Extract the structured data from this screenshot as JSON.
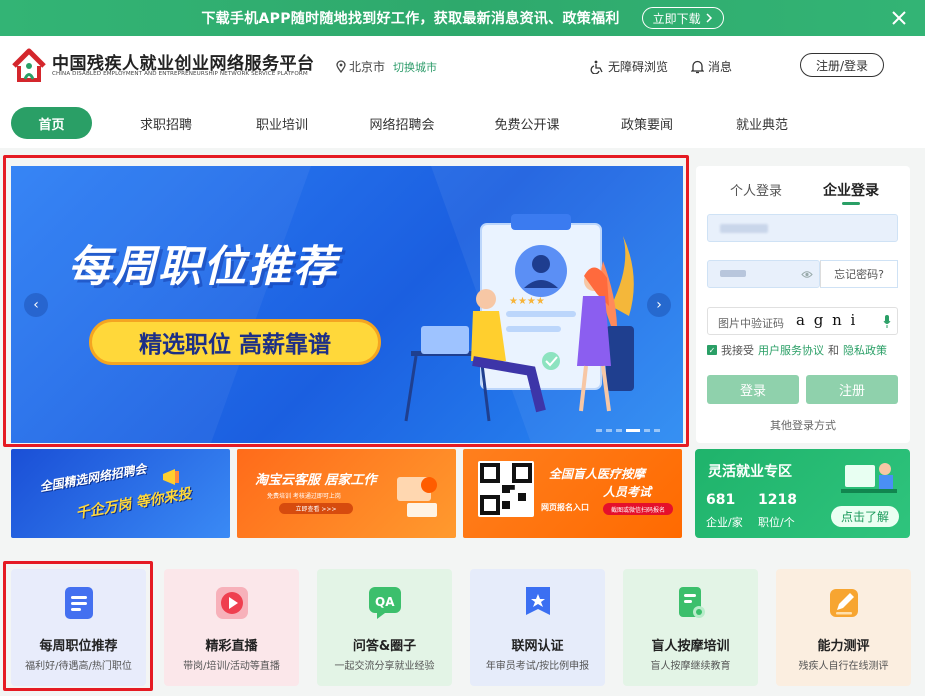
{
  "promo_bar": {
    "text": "下载手机APP随时随地找到好工作，获取最新消息资讯、政策福利",
    "button": "立即下载"
  },
  "header": {
    "title": "中国残疾人就业创业网络服务平台",
    "subtitle": "CHINA DISABLED EMPLOYMENT AND ENTREPRENEURSHIP NETWORK SERVICE PLATFORM",
    "city": "北京市",
    "switch_city": "切换城市",
    "accessibility": "无障碍浏览",
    "messages": "消息",
    "login_register": "注册/登录"
  },
  "nav": {
    "items": [
      "首页",
      "求职招聘",
      "职业培训",
      "网络招聘会",
      "免费公开课",
      "政策要闻",
      "就业典范"
    ],
    "active_index": 0
  },
  "banner": {
    "title": "每周职位推荐",
    "pill": "精选职位 高薪靠谱",
    "slide_count": 6,
    "active_slide": 3
  },
  "login": {
    "tabs": [
      "个人登录",
      "企业登录"
    ],
    "active_tab": 1,
    "forgot_password": "忘记密码?",
    "captcha_placeholder": "图片中验证码",
    "captcha_text": "a g n i",
    "agree_prefix": "我接受",
    "service_agreement": "用户服务协议",
    "and": "和",
    "privacy_policy": "隐私政策",
    "login_button": "登录",
    "register_button": "注册",
    "other_methods": "其他登录方式"
  },
  "promo_tiles": [
    {
      "line1": "全国精选网络招聘会",
      "line2": "千企万岗 等你来投"
    },
    {
      "line1": "淘宝云客服 居家工作",
      "line2": "免费培训 考核通过即可上岗",
      "button": "立即查看 >>>"
    },
    {
      "line1": "全国盲人医疗按摩",
      "line2": "人员考试",
      "line3": "网页报名入口",
      "button": "截图或微信扫码报名"
    },
    {
      "title": "灵活就业专区",
      "stat1_value": "681",
      "stat1_label": "企业/家",
      "stat2_value": "1218",
      "stat2_label": "职位/个",
      "button": "点击了解"
    }
  ],
  "feature_cards": [
    {
      "title": "每周职位推荐",
      "sub": "福利好/待遇高/热门职位",
      "color": "#e8ecfb",
      "icon": "document-icon"
    },
    {
      "title": "精彩直播",
      "sub": "带岗/培训/活动等直播",
      "color": "#fbe7ea",
      "icon": "play-icon"
    },
    {
      "title": "问答&圈子",
      "sub": "一起交流分享就业经验",
      "color": "#e3f4e6",
      "icon": "qa-icon"
    },
    {
      "title": "联网认证",
      "sub": "年审员考试/按比例申报",
      "color": "#e6ecfa",
      "icon": "badge-icon"
    },
    {
      "title": "盲人按摩培训",
      "sub": "盲人按摩继续教育",
      "color": "#e3f4e6",
      "icon": "certificate-icon"
    },
    {
      "title": "能力测评",
      "sub": "残疾人自行在线测评",
      "color": "#fbeee0",
      "icon": "edit-icon"
    }
  ]
}
